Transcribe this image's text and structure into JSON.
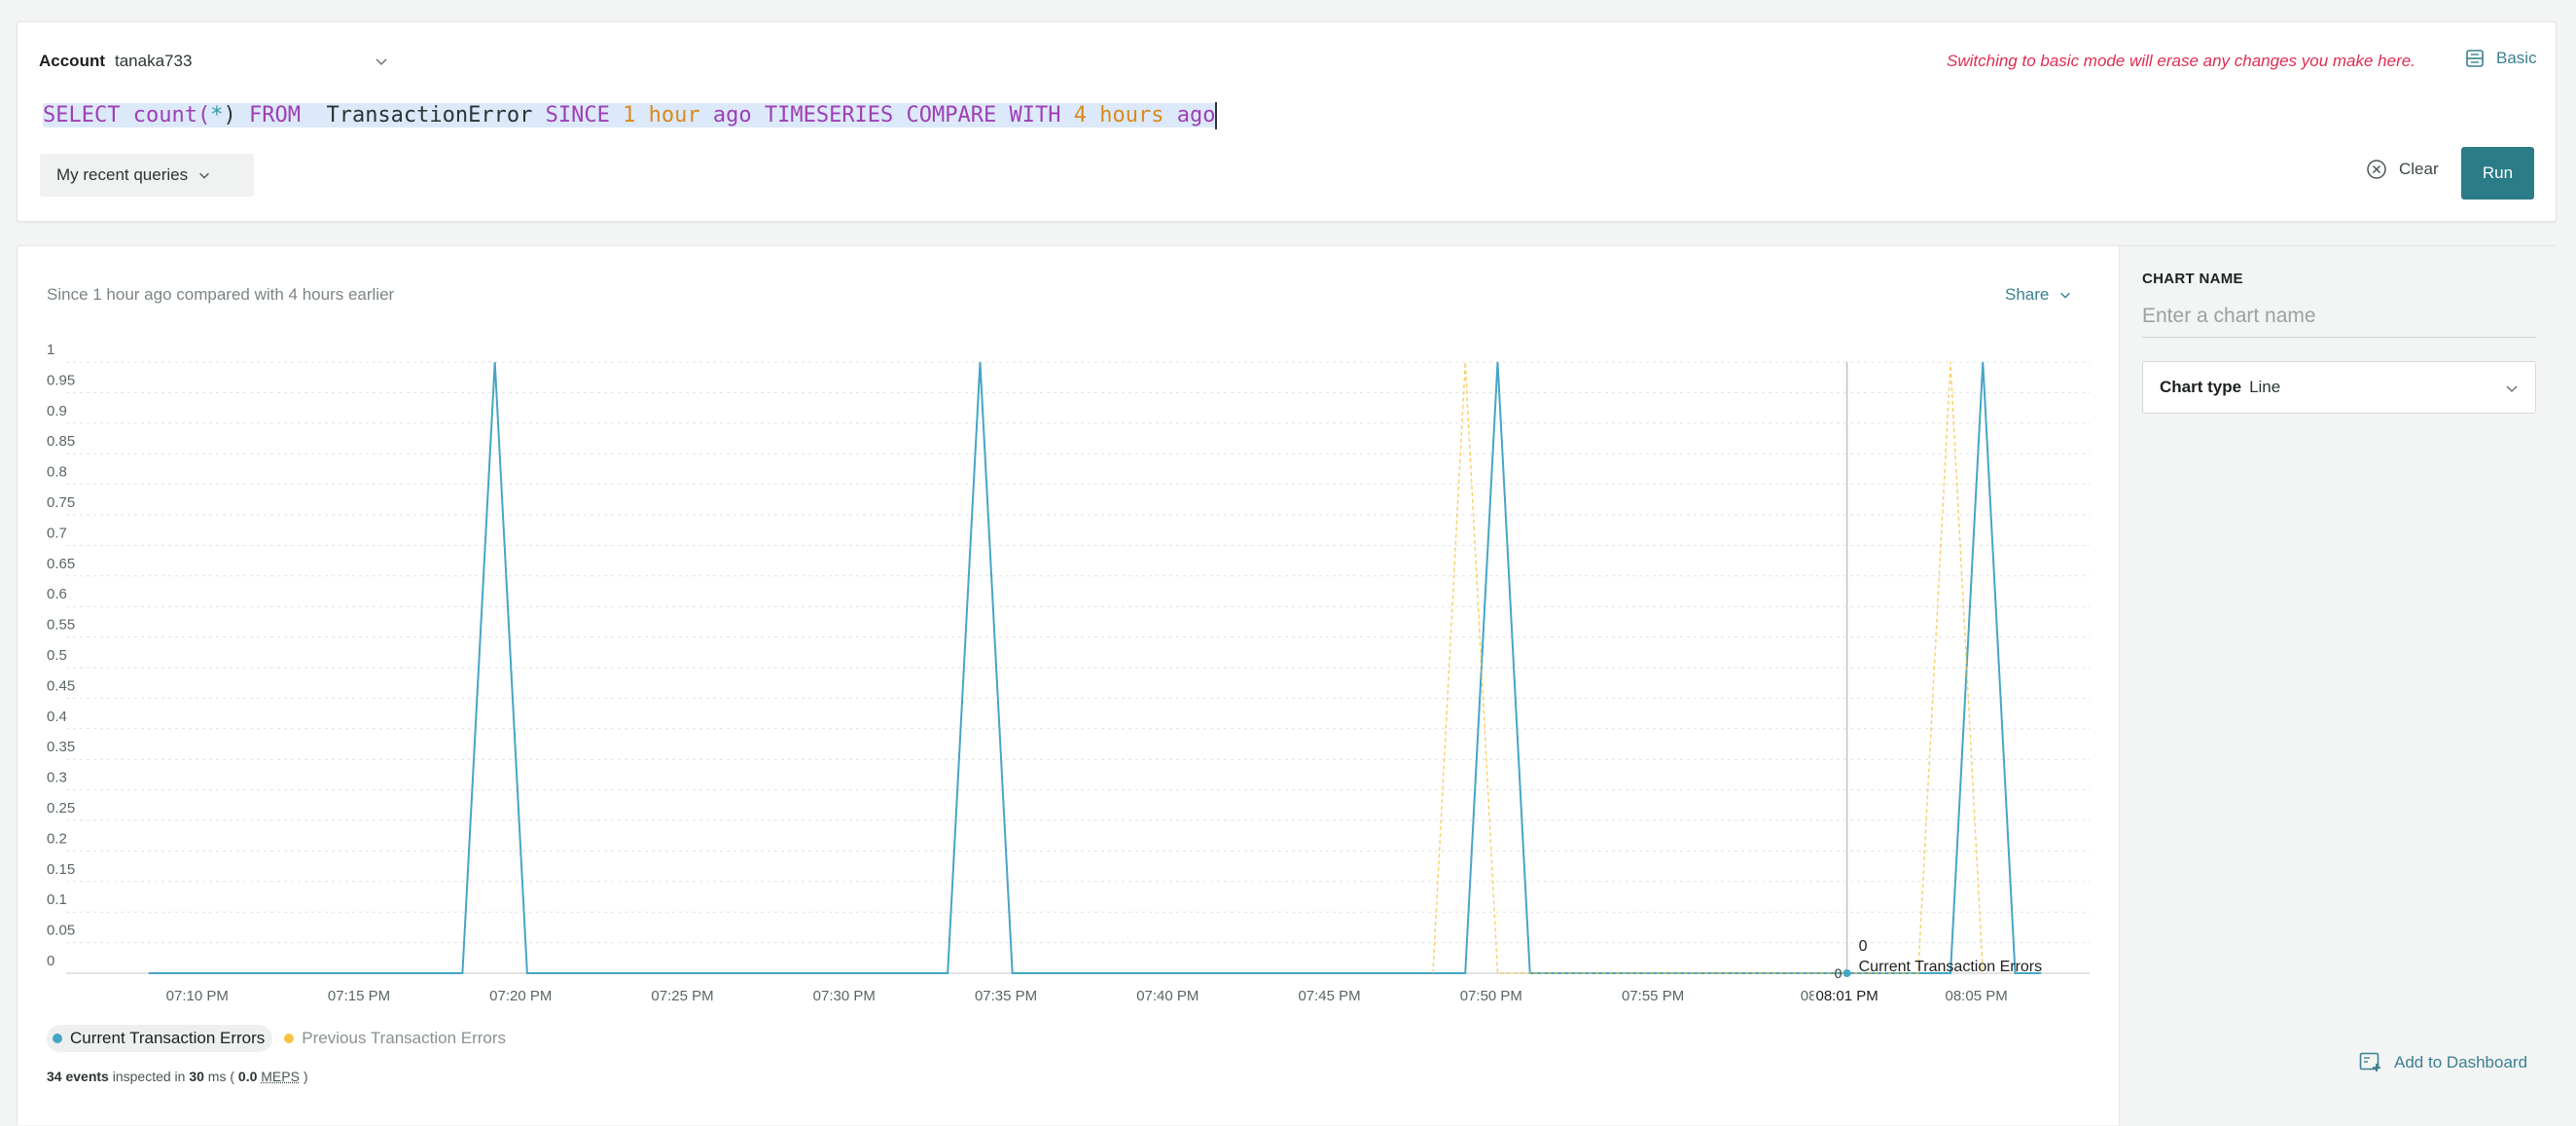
{
  "query_panel": {
    "account_label": "Account",
    "account_value": "tanaka733",
    "warning": "Switching to basic mode will erase any changes you make here.",
    "basic_label": "Basic",
    "query_tokens": {
      "t1": "SELECT",
      "t2": "count(",
      "t3": "*",
      "t4": ")",
      "t5": "FROM",
      "t6": "TransactionError",
      "t7": "SINCE",
      "t8": "1 hour",
      "t9": "ago",
      "t10": "TIMESERIES",
      "t11": "COMPARE",
      "t12": "WITH",
      "t13": "4 hours",
      "t14": "ago"
    },
    "recent_queries_label": "My recent queries",
    "clear_label": "Clear",
    "run_label": "Run"
  },
  "results": {
    "summary": "Since 1 hour ago compared with 4 hours earlier",
    "share_label": "Share",
    "legend": [
      {
        "label": "Current Transaction Errors",
        "color": "#46a5c6"
      },
      {
        "label": "Previous Transaction Errors",
        "color": "#f5c342"
      }
    ],
    "events": {
      "count": "34 events",
      "mid": "inspected in",
      "ms": "30",
      "ms_unit": "ms (",
      "meps_val": "0.0",
      "meps": "MEPS",
      "end": ")"
    },
    "tooltip": {
      "value": "0",
      "series": "Current Transaction Errors",
      "time": "08:01 PM",
      "axis_zero": "0"
    }
  },
  "sidebar": {
    "chart_name_label": "CHART NAME",
    "chart_name_placeholder": "Enter a chart name",
    "chart_type_label": "Chart type",
    "chart_type_value": "Line",
    "add_to_dashboard": "Add to Dashboard"
  },
  "chart_data": {
    "type": "line",
    "x_unit": "minutes after 07:07 PM",
    "xlim": [
      0,
      61.5
    ],
    "ylim": [
      0,
      1
    ],
    "y_ticks": [
      0,
      0.05,
      0.1,
      0.15,
      0.2,
      0.25,
      0.3,
      0.35,
      0.4,
      0.45,
      0.5,
      0.55,
      0.6,
      0.65,
      0.7,
      0.75,
      0.8,
      0.85,
      0.9,
      0.95,
      1
    ],
    "y_tick_labels": [
      "0",
      "0.05",
      "0.1",
      "0.15",
      "0.2",
      "0.25",
      "0.3",
      "0.35",
      "0.4",
      "0.45",
      "0.5",
      "0.55",
      "0.6",
      "0.65",
      "0.7",
      "0.75",
      "0.8",
      "0.85",
      "0.9",
      "0.95",
      "1"
    ],
    "x_ticks": [
      {
        "t": 3,
        "label": "07:10 PM"
      },
      {
        "t": 8,
        "label": "07:15 PM"
      },
      {
        "t": 13,
        "label": "07:20 PM"
      },
      {
        "t": 18,
        "label": "07:25 PM"
      },
      {
        "t": 23,
        "label": "07:30 PM"
      },
      {
        "t": 28,
        "label": "07:35 PM"
      },
      {
        "t": 33,
        "label": "07:40 PM"
      },
      {
        "t": 38,
        "label": "07:45 PM"
      },
      {
        "t": 43,
        "label": "07:50 PM"
      },
      {
        "t": 48,
        "label": "07:55 PM"
      },
      {
        "t": 53,
        "label": "08:0"
      },
      {
        "t": 58,
        "label": "08:05 PM"
      }
    ],
    "grid": true,
    "legend_position": "bottom-left",
    "crosshair_t": 54,
    "series": [
      {
        "name": "Current Transaction Errors",
        "color": "#46a5c6",
        "points": [
          [
            1.5,
            0
          ],
          [
            11.2,
            0
          ],
          [
            12.2,
            1
          ],
          [
            13.2,
            0
          ],
          [
            26.2,
            0
          ],
          [
            27.2,
            1
          ],
          [
            28.2,
            0
          ],
          [
            42.2,
            0
          ],
          [
            43.2,
            1
          ],
          [
            44.2,
            0
          ],
          [
            57.2,
            0
          ],
          [
            58.2,
            1
          ],
          [
            59.2,
            0
          ],
          [
            60,
            0
          ]
        ]
      },
      {
        "name": "Previous Transaction Errors",
        "color": "#f5c342",
        "points": [
          [
            41.2,
            0
          ],
          [
            42.2,
            1
          ],
          [
            43.2,
            0
          ],
          [
            56.2,
            0
          ],
          [
            57.2,
            1
          ],
          [
            58.2,
            0
          ]
        ]
      }
    ]
  }
}
